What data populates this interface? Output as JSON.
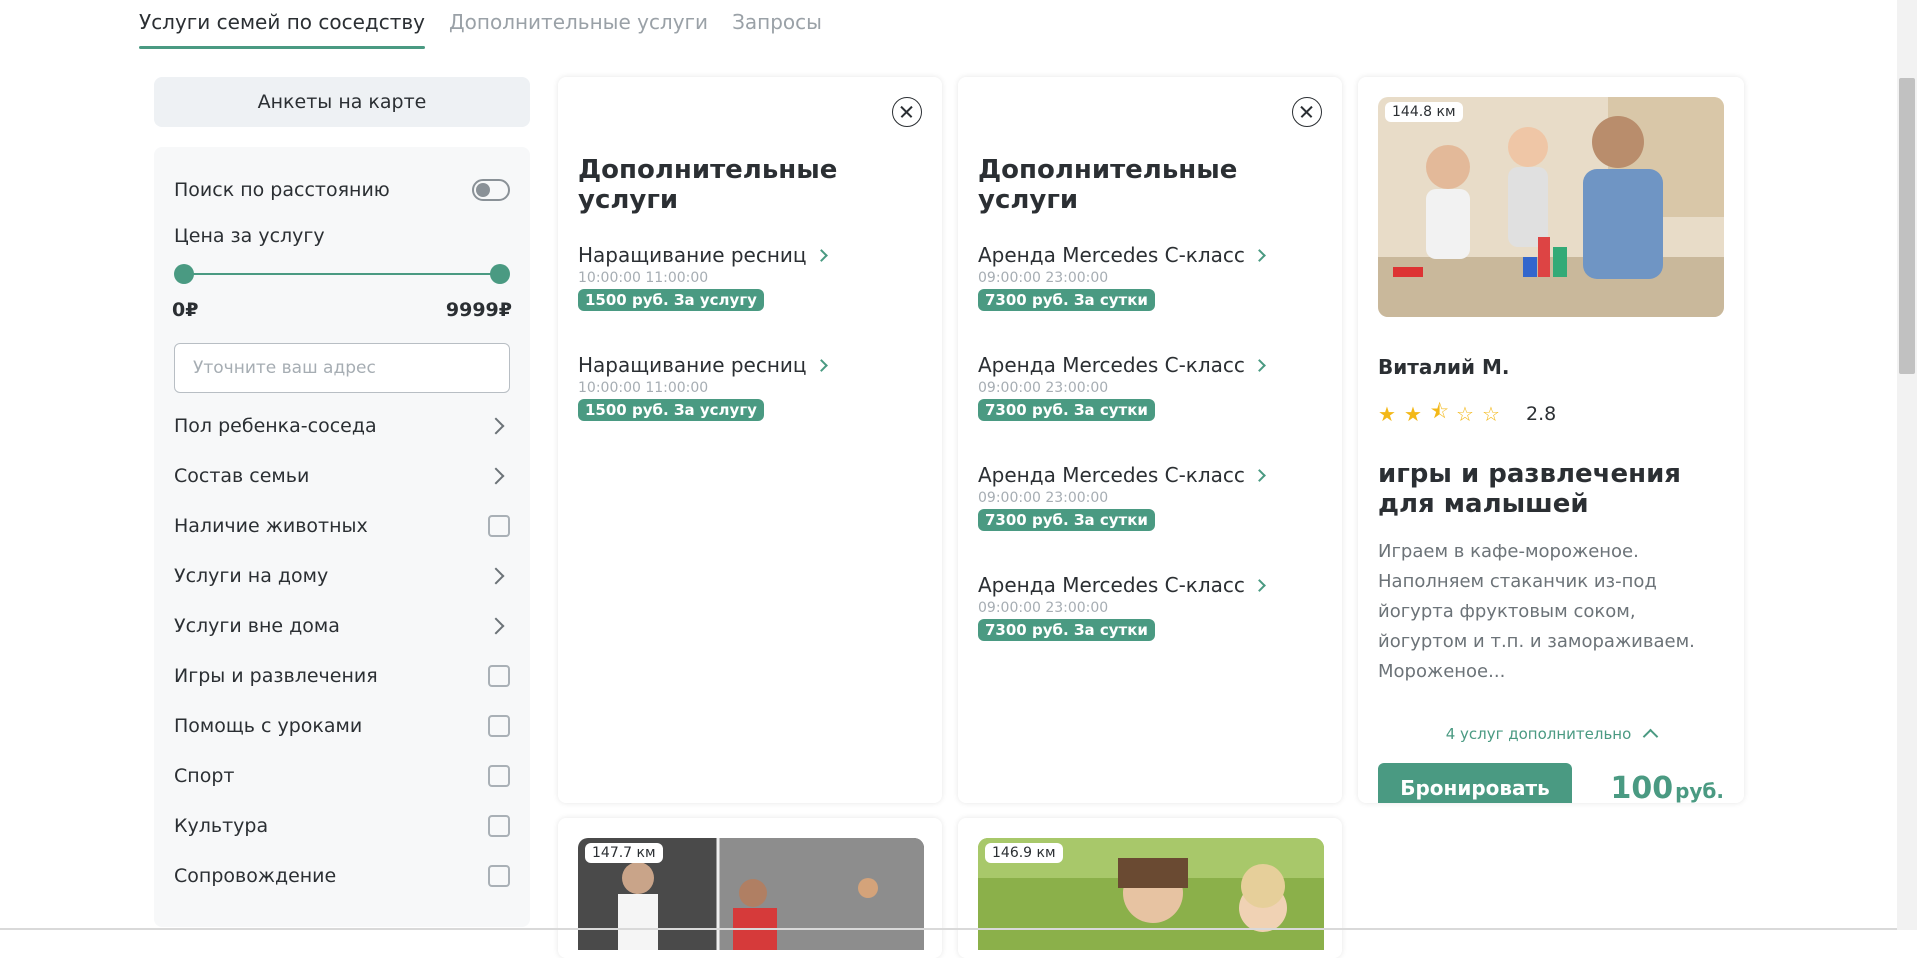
{
  "tabs": [
    {
      "label": "Услуги семей по соседству",
      "active": true
    },
    {
      "label": "Дополнительные услуги",
      "active": false
    },
    {
      "label": "Запросы",
      "active": false
    }
  ],
  "sidebar": {
    "map_button": "Анкеты на карте",
    "distance_search_label": "Поиск по расстоянию",
    "distance_search_on": false,
    "price_label": "Цена за услугу",
    "price_min": "0₽",
    "price_max": "9999₽",
    "address_placeholder": "Уточните ваш адрес",
    "options": [
      {
        "label": "Пол ребенка-соседа",
        "kind": "expand"
      },
      {
        "label": "Состав семьи",
        "kind": "expand"
      },
      {
        "label": "Наличие животных",
        "kind": "checkbox"
      },
      {
        "label": "Услуги на дому",
        "kind": "expand"
      },
      {
        "label": "Услуги вне дома",
        "kind": "expand"
      },
      {
        "label": "Игры и развлечения",
        "kind": "checkbox"
      },
      {
        "label": "Помощь с уроками",
        "kind": "checkbox"
      },
      {
        "label": "Спорт",
        "kind": "checkbox"
      },
      {
        "label": "Культура",
        "kind": "checkbox"
      },
      {
        "label": "Сопровождение",
        "kind": "checkbox"
      }
    ]
  },
  "service_cards": [
    {
      "title": "Дополнительные услуги",
      "items": [
        {
          "name": "Наращивание ресниц",
          "time": "10:00:00 11:00:00",
          "price": "1500 руб. За услугу"
        },
        {
          "name": "Наращивание ресниц",
          "time": "10:00:00 11:00:00",
          "price": "1500 руб. За услугу"
        }
      ]
    },
    {
      "title": "Дополнительные услуги",
      "items": [
        {
          "name": "Аренда Mercedes C-класс",
          "time": "09:00:00 23:00:00",
          "price": "7300 руб. За сутки"
        },
        {
          "name": "Аренда Mercedes C-класс",
          "time": "09:00:00 23:00:00",
          "price": "7300 руб. За сутки"
        },
        {
          "name": "Аренда Mercedes C-класс",
          "time": "09:00:00 23:00:00",
          "price": "7300 руб. За сутки"
        },
        {
          "name": "Аренда Mercedes C-класс",
          "time": "09:00:00 23:00:00",
          "price": "7300 руб. За сутки"
        }
      ]
    }
  ],
  "profile": {
    "distance": "144.8 км",
    "name": "Виталий М.",
    "rating_value": "2.8",
    "rating_stars": 2.5,
    "title": "игры и развлечения для малышей",
    "description": "Играем в кафе-мороженое. Наполняем стаканчик из-под йогурта фруктовым соком, йогуртом и т.п. и замораживаем. Мороженое...",
    "more_label": "4 услуг дополнительно",
    "book_label": "Бронировать",
    "price_amount": "100",
    "price_currency": "руб."
  },
  "bottom_cards": [
    {
      "distance": "147.7 км"
    },
    {
      "distance": "146.9 км"
    }
  ],
  "colors": {
    "accent": "#4a9a82",
    "star": "#f3b818"
  },
  "icons": [
    "close-icon",
    "chevron-right-icon",
    "chevron-up-icon",
    "star-icon"
  ]
}
